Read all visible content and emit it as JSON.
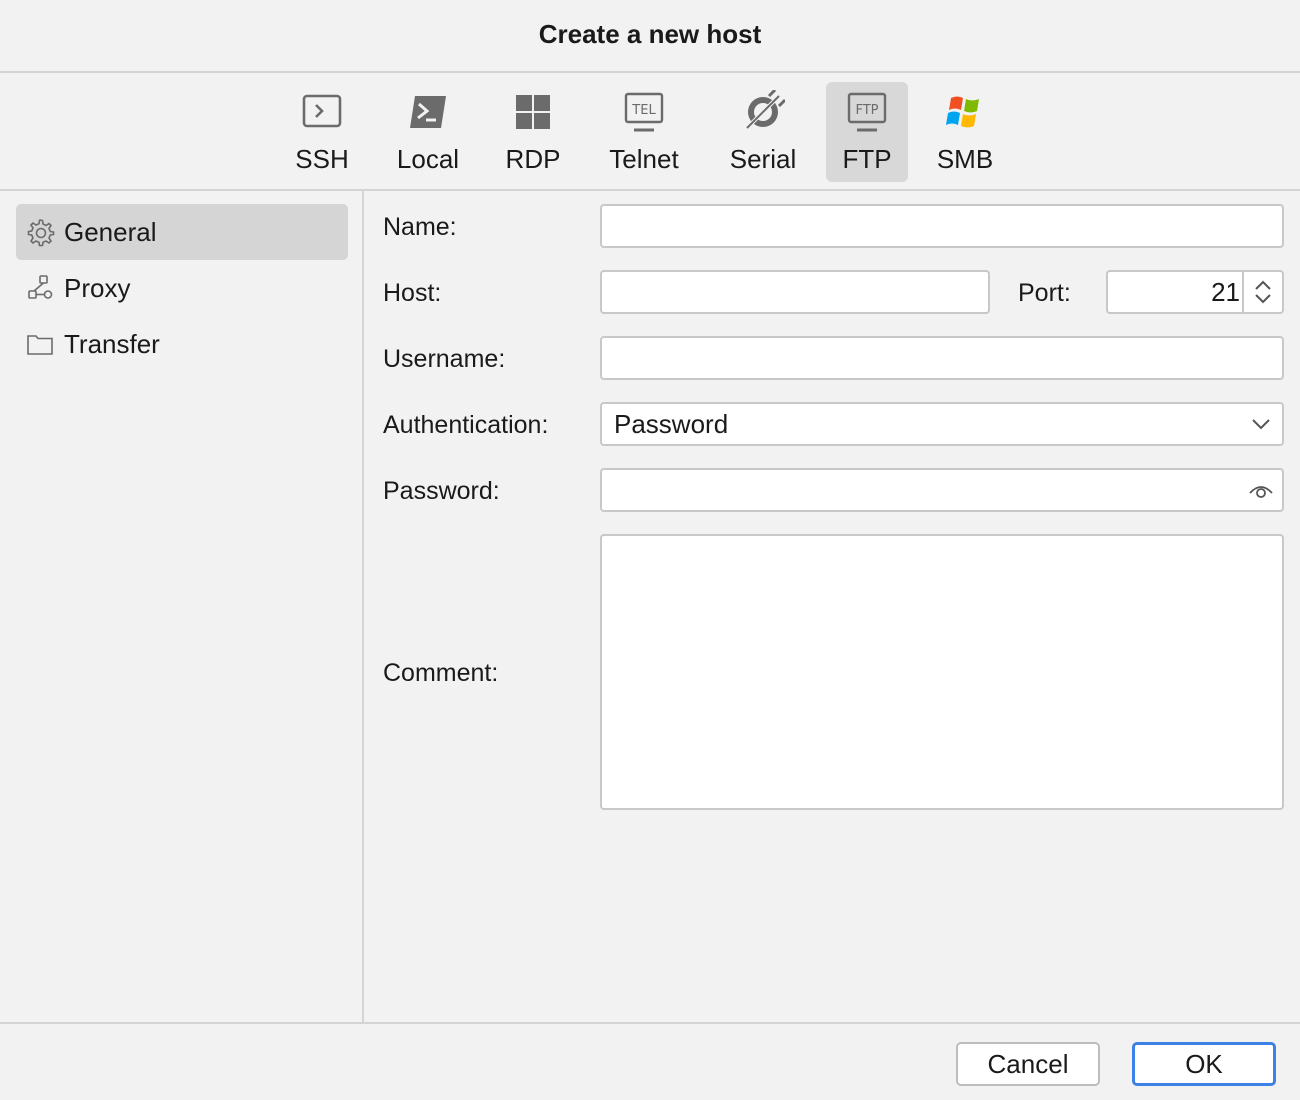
{
  "window": {
    "title": "Create a new host"
  },
  "host_types": [
    {
      "label": "SSH",
      "icon": "terminal-icon"
    },
    {
      "label": "Local",
      "icon": "powershell-icon"
    },
    {
      "label": "RDP",
      "icon": "windows-grid-icon"
    },
    {
      "label": "Telnet",
      "icon": "telnet-monitor-icon"
    },
    {
      "label": "Serial",
      "icon": "serial-plug-icon"
    },
    {
      "label": "FTP",
      "icon": "ftp-monitor-icon",
      "selected": true
    },
    {
      "label": "SMB",
      "icon": "windows-flag-icon"
    }
  ],
  "sidebar": {
    "items": [
      {
        "label": "General",
        "icon": "gear-icon",
        "selected": true
      },
      {
        "label": "Proxy",
        "icon": "network-icon"
      },
      {
        "label": "Transfer",
        "icon": "folder-icon"
      }
    ]
  },
  "form": {
    "name_label": "Name:",
    "name_value": "",
    "host_label": "Host:",
    "host_value": "",
    "port_label": "Port:",
    "port_value": "21",
    "username_label": "Username:",
    "username_value": "",
    "auth_label": "Authentication:",
    "auth_value": "Password",
    "password_label": "Password:",
    "password_value": "",
    "comment_label": "Comment:",
    "comment_value": ""
  },
  "footer": {
    "cancel_label": "Cancel",
    "ok_label": "OK"
  },
  "colors": {
    "accent": "#3c82e6",
    "selected_bg": "#d5d5d5",
    "window_bg": "#f2f2f2"
  }
}
